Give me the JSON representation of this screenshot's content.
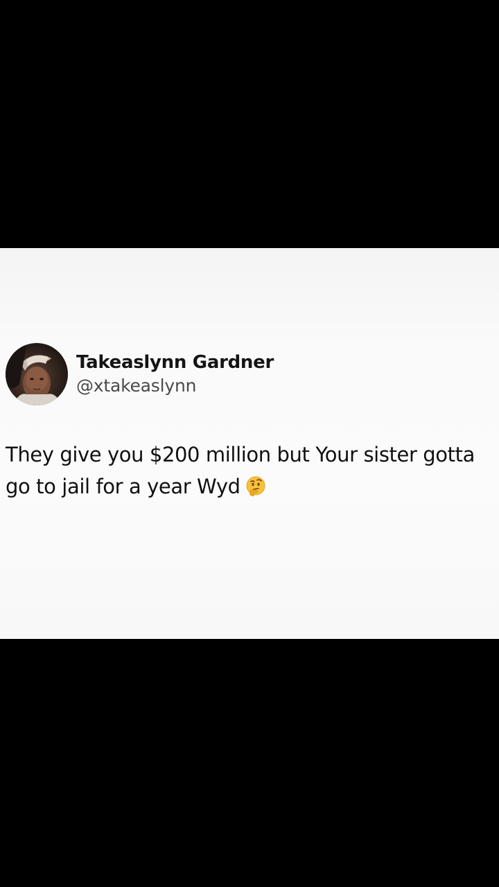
{
  "tweet": {
    "display_name": "Takeaslynn Gardner",
    "handle": "@xtakeaslynn",
    "text": "They give you $200 million but Your sister gotta go to jail for a year Wyd",
    "emoji": "thinking-face-icon"
  },
  "colors": {
    "letterbox": "#000000",
    "card_background": "#fafafa",
    "name_text": "#141414",
    "handle_text": "#4a4a4a",
    "body_text": "#101010"
  }
}
